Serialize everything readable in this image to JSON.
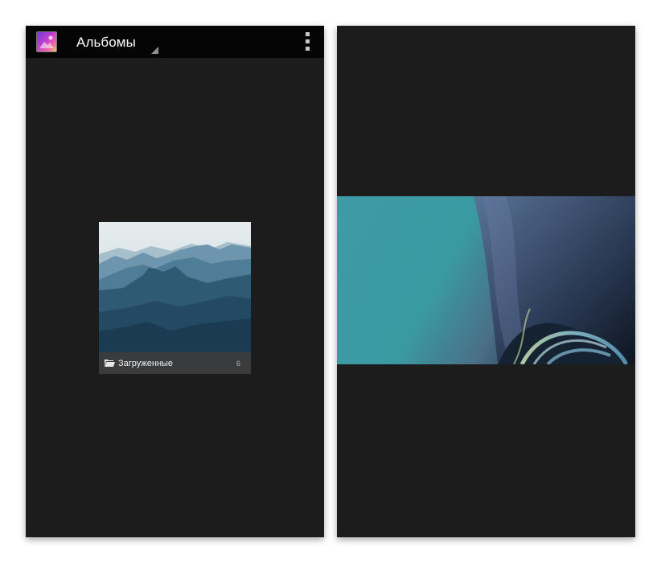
{
  "left_screen": {
    "action_bar": {
      "app_icon": "gallery-app-icon",
      "spinner_label": "Альбомы",
      "overflow_icon": "overflow-menu-icon"
    },
    "album": {
      "name": "Загруженные",
      "count": "6",
      "icon": "folder-icon",
      "thumbnail": "mountain-silhouette-photo"
    }
  },
  "right_screen": {
    "image": "teal-abstract-wallpaper"
  },
  "colors": {
    "screen_background": "#1c1c1c",
    "action_bar": "#050505",
    "album_footer": "#3a3b3d"
  }
}
